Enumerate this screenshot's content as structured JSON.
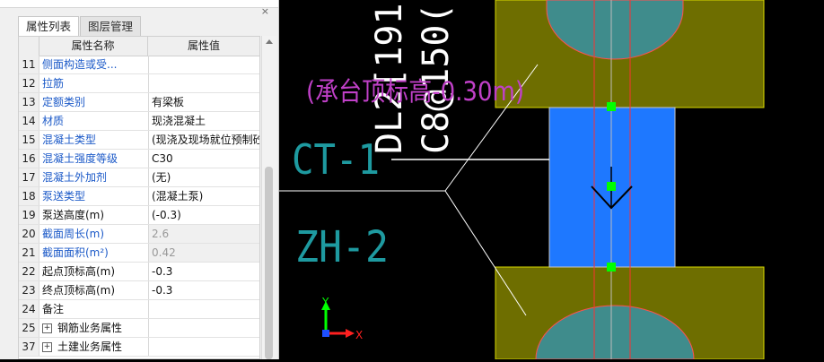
{
  "panel": {
    "close_glyph": "×",
    "tabs": [
      "属性列表",
      "图层管理"
    ],
    "columns": {
      "name": "属性名称",
      "value": "属性值"
    },
    "rows": [
      {
        "num": "11",
        "name": "侧面构造或受...",
        "value": "",
        "style": "blue"
      },
      {
        "num": "12",
        "name": "拉筋",
        "value": "",
        "style": "blue"
      },
      {
        "num": "13",
        "name": "定额类别",
        "value": "有梁板",
        "style": "blue"
      },
      {
        "num": "14",
        "name": "材质",
        "value": "现浇混凝土",
        "style": "blue"
      },
      {
        "num": "15",
        "name": "混凝土类型",
        "value": "(现浇及现场就位预制砼)",
        "style": "blue"
      },
      {
        "num": "16",
        "name": "混凝土强度等级",
        "value": "C30",
        "style": "blue"
      },
      {
        "num": "17",
        "name": "混凝土外加剂",
        "value": "(无)",
        "style": "blue"
      },
      {
        "num": "18",
        "name": "泵送类型",
        "value": "(混凝土泵)",
        "style": "blue"
      },
      {
        "num": "19",
        "name": "泵送高度(m)",
        "value": "(-0.3)",
        "style": "black"
      },
      {
        "num": "20",
        "name": "截面周长(m)",
        "value": "2.6",
        "style": "blue",
        "gray": true
      },
      {
        "num": "21",
        "name": "截面面积(m²)",
        "value": "0.42",
        "style": "blue",
        "gray": true
      },
      {
        "num": "22",
        "name": "起点顶标高(m)",
        "value": "-0.3",
        "style": "black"
      },
      {
        "num": "23",
        "name": "终点顶标高(m)",
        "value": "-0.3",
        "style": "black"
      },
      {
        "num": "24",
        "name": "备注",
        "value": "",
        "style": "black"
      },
      {
        "num": "25",
        "name": "钢筋业务属性",
        "value": "",
        "style": "black",
        "expander": "+"
      },
      {
        "num": "37",
        "name": "土建业务属性",
        "value": "",
        "style": "black",
        "expander": "+"
      }
    ]
  },
  "cad": {
    "text_beam": "DL2[191",
    "text_rebar": "C8@150(",
    "text_note": "(承台顶标高-0.30m)",
    "label_ct": "CT-1",
    "label_zh": "ZH-2",
    "axis_y": "Y",
    "axis_x": "X",
    "colors": {
      "cap_fill": "#6e6e00",
      "beam_fill": "#1e78ff",
      "pile_fill": "#3f8c8c",
      "red_line": "#ff3030",
      "grip": "#00ff00",
      "cyan_text": "#1e9aa0",
      "magenta_text": "#c040c8"
    }
  }
}
